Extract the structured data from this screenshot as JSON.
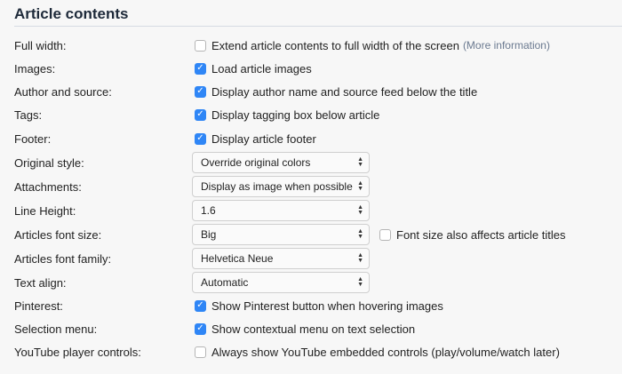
{
  "title": "Article contents",
  "rows": [
    {
      "label": "Full width:",
      "type": "checkbox",
      "checked": false,
      "text": "Extend article contents to full width of the screen",
      "link": "(More information)"
    },
    {
      "label": "Images:",
      "type": "checkbox",
      "checked": true,
      "text": "Load article images"
    },
    {
      "label": "Author and source:",
      "type": "checkbox",
      "checked": true,
      "text": "Display author name and source feed below the title"
    },
    {
      "label": "Tags:",
      "type": "checkbox",
      "checked": true,
      "text": "Display tagging box below article"
    },
    {
      "label": "Footer:",
      "type": "checkbox",
      "checked": true,
      "text": "Display article footer"
    },
    {
      "label": "Original style:",
      "type": "select",
      "value": "Override original colors"
    },
    {
      "label": "Attachments:",
      "type": "select",
      "value": "Display as image when possible"
    },
    {
      "label": "Line Height:",
      "type": "select",
      "value": "1.6"
    },
    {
      "label": "Articles font size:",
      "type": "select",
      "value": "Big",
      "extra": {
        "checked": false,
        "text": "Font size also affects article titles"
      }
    },
    {
      "label": "Articles font family:",
      "type": "select",
      "value": "Helvetica Neue"
    },
    {
      "label": "Text align:",
      "type": "select",
      "value": "Automatic"
    },
    {
      "label": "Pinterest:",
      "type": "checkbox",
      "checked": true,
      "text": "Show Pinterest button when hovering images"
    },
    {
      "label": "Selection menu:",
      "type": "checkbox",
      "checked": true,
      "text": "Show contextual menu on text selection"
    },
    {
      "label": "YouTube player controls:",
      "type": "checkbox",
      "checked": false,
      "text": "Always show YouTube embedded controls (play/volume/watch later)"
    }
  ]
}
